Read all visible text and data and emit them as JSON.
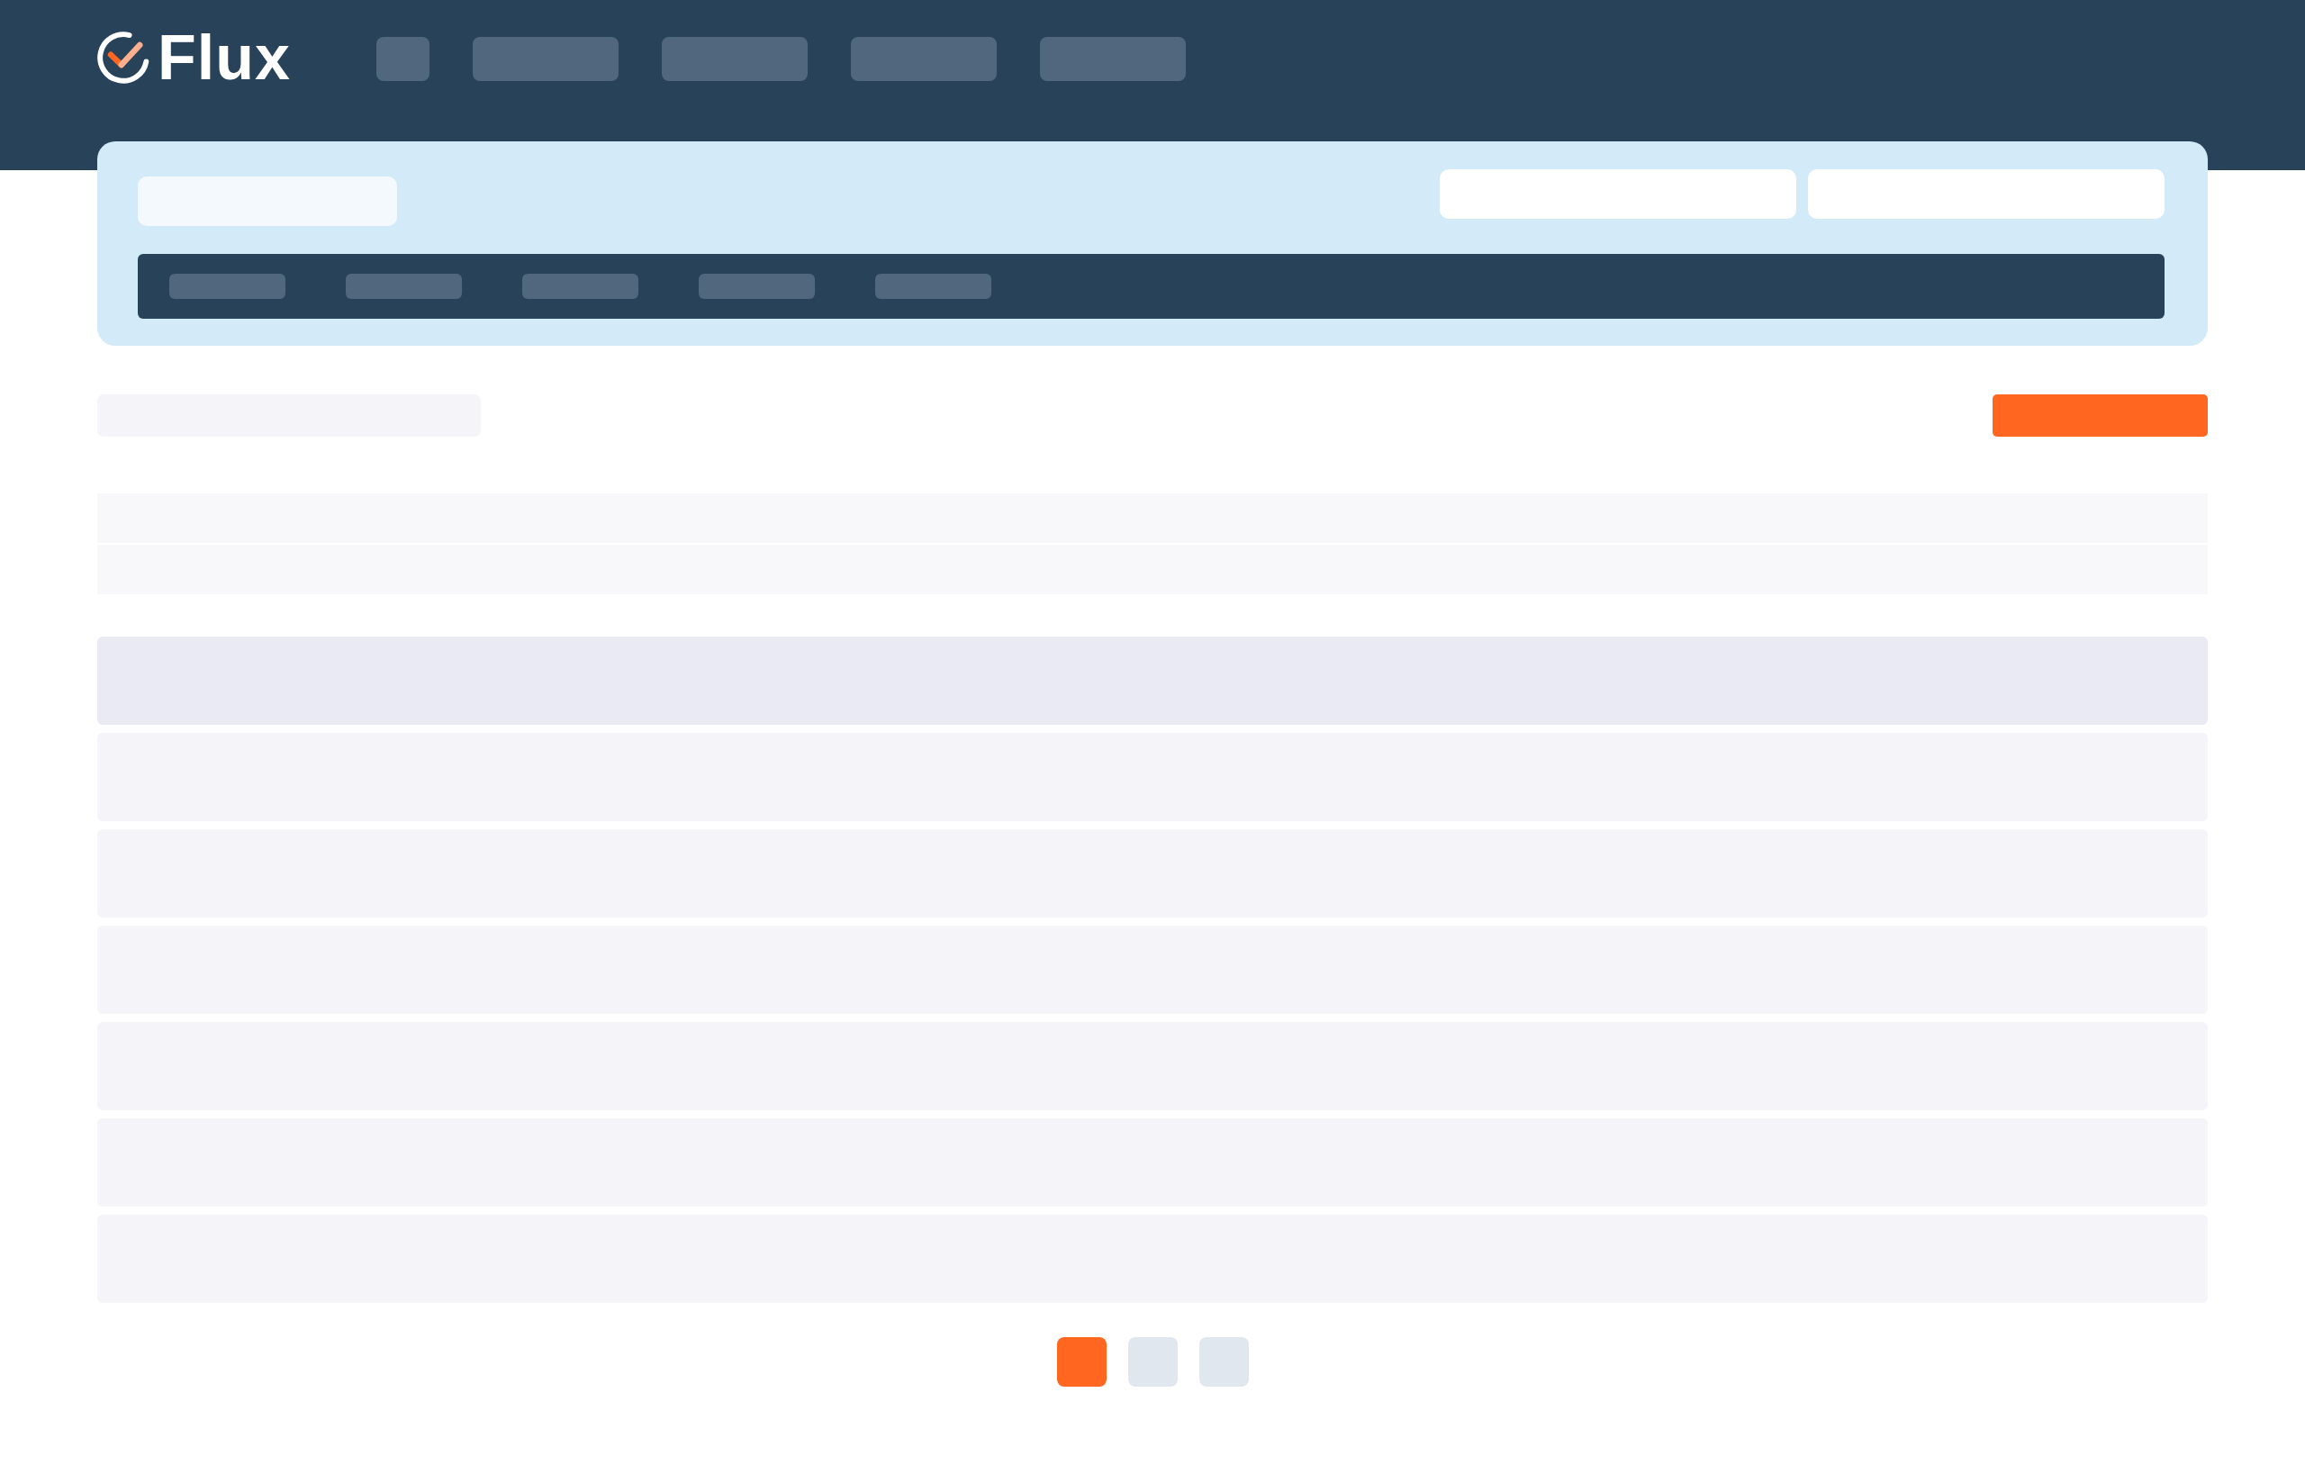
{
  "header": {
    "logo": "Flux",
    "nav": [
      {
        "kind": "short"
      },
      {
        "kind": "long"
      },
      {
        "kind": "long"
      },
      {
        "kind": "long"
      },
      {
        "kind": "long"
      }
    ]
  },
  "panel": {
    "title": {
      "kind": "bar"
    },
    "fields": [
      {
        "kind": "input"
      },
      {
        "kind": "input"
      }
    ],
    "tabs": [
      {
        "kind": "bar"
      },
      {
        "kind": "bar"
      },
      {
        "kind": "bar"
      },
      {
        "kind": "bar"
      },
      {
        "kind": "bar"
      }
    ]
  },
  "toolbar": {
    "search": {
      "kind": "bar"
    },
    "action": {
      "kind": "button"
    }
  },
  "summary": [
    {
      "kind": "bar"
    },
    {
      "kind": "bar"
    }
  ],
  "table": [
    {
      "kind": "header"
    },
    {
      "kind": "row"
    },
    {
      "kind": "row"
    },
    {
      "kind": "row"
    },
    {
      "kind": "row"
    },
    {
      "kind": "row"
    },
    {
      "kind": "row"
    }
  ],
  "pagination": [
    {
      "selected": true
    },
    {
      "selected": false
    },
    {
      "selected": false
    }
  ]
}
